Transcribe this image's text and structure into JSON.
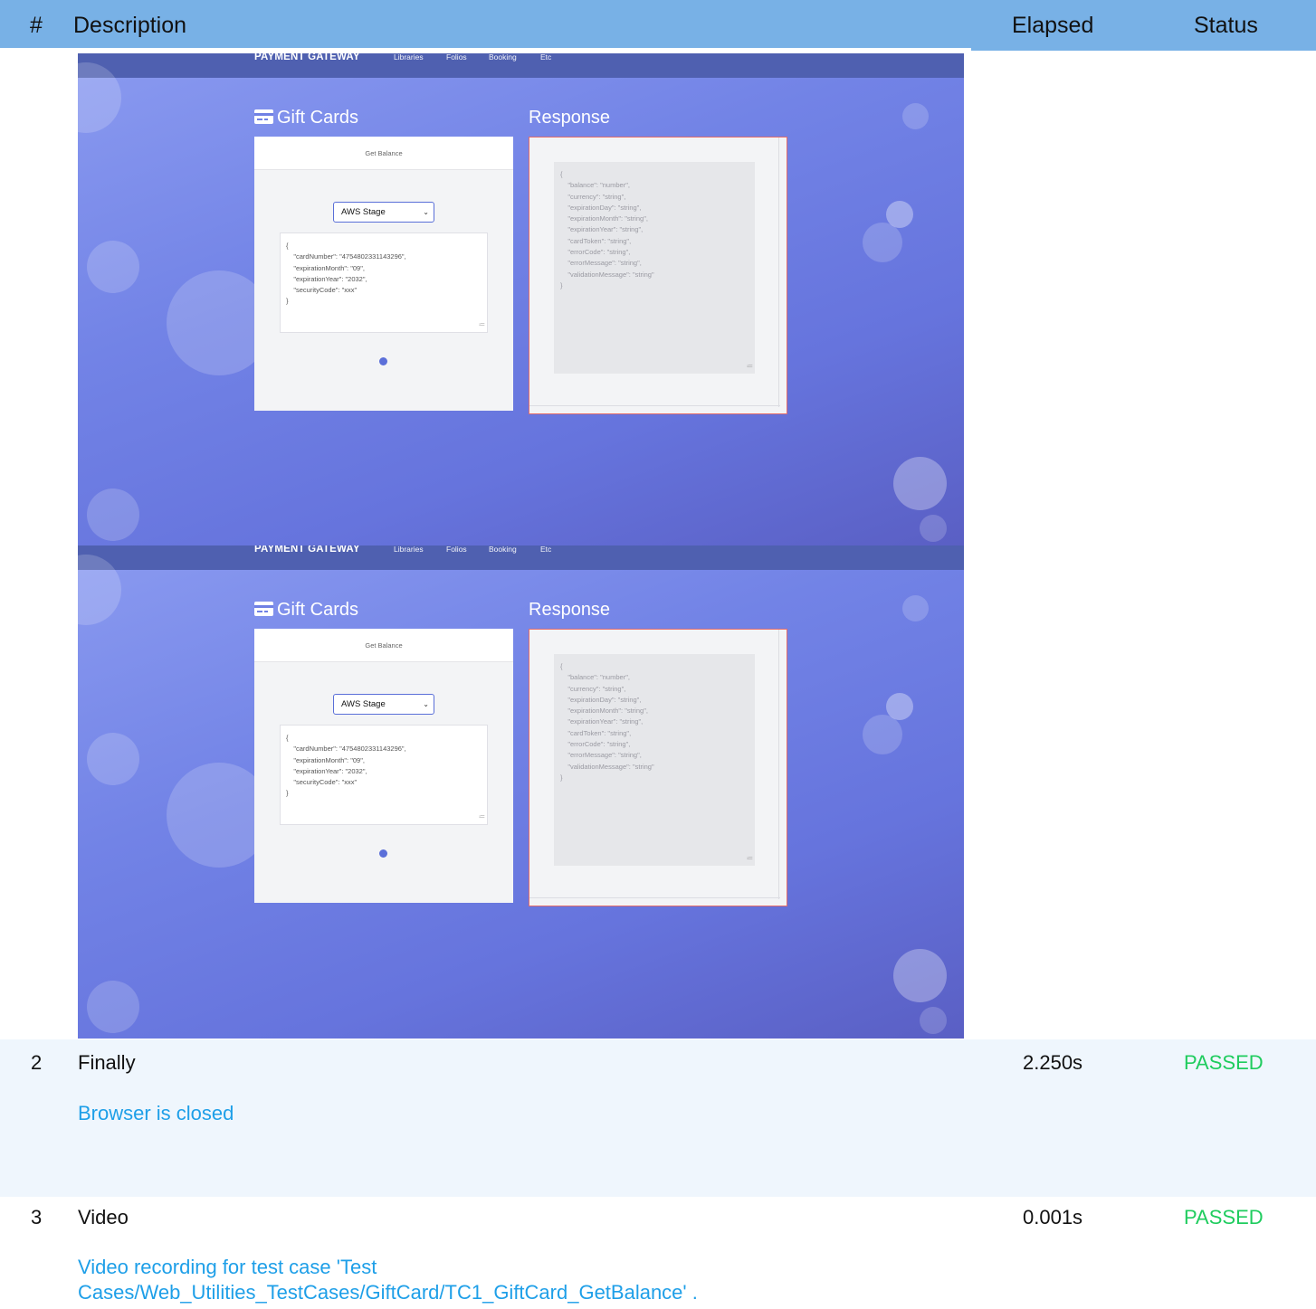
{
  "table_header": {
    "num": "#",
    "description": "Description",
    "elapsed": "Elapsed",
    "status": "Status"
  },
  "screenshot": {
    "nav": {
      "brand": "PAYMENT GATEWAY",
      "links": [
        "Libraries",
        "Folios",
        "Booking",
        "Etc"
      ]
    },
    "left_title": "Gift Cards",
    "right_title": "Response",
    "card_header": "Get Balance",
    "select_value": "AWS Stage",
    "request_json": "{\n    \"cardNumber\": \"4754802331143296\",\n    \"expirationMonth\": \"09\",\n    \"expirationYear\": \"2032\",\n    \"securityCode\": \"xxx\"\n}",
    "response_json": "{\n    \"balance\": \"number\",\n    \"currency\": \"string\",\n    \"expirationDay\": \"string\",\n    \"expirationMonth\": \"string\",\n    \"expirationYear\": \"string\",\n    \"cardToken\": \"string\",\n    \"errorCode\": \"string\",\n    \"errorMessage\": \"string\",\n    \"validationMessage\": \"string\"\n}",
    "colors": {
      "nav_bg": "#4f60b0",
      "gradient_start": "#8a9af0",
      "gradient_end": "#5a5fc4",
      "accent": "#5b6fd9"
    }
  },
  "rows": [
    {
      "num": "2",
      "description": "Finally",
      "elapsed": "2.250s",
      "status": "PASSED",
      "detail": "Browser is closed"
    },
    {
      "num": "3",
      "description": "Video",
      "elapsed": "0.001s",
      "status": "PASSED",
      "detail_line1": "Video recording for test case 'Test",
      "detail_line2": "Cases/Web_Utilities_TestCases/GiftCard/TC1_GiftCard_GetBalance' ."
    }
  ],
  "icons": {
    "card": "credit-card-icon",
    "dropdown": "chevron-down-icon"
  },
  "status_color": "#1fcc5e",
  "link_color": "#1e9fe8"
}
